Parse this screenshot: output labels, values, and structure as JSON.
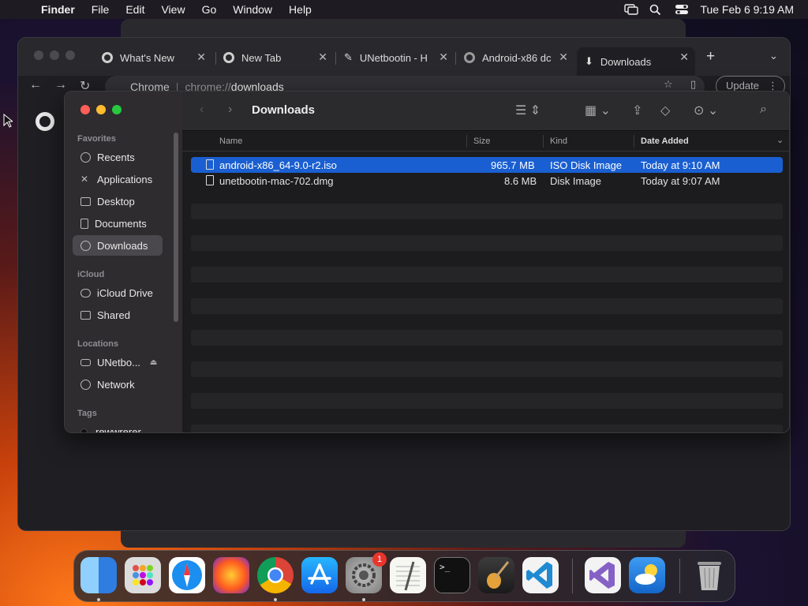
{
  "menubar": {
    "app_name": "Finder",
    "menus": [
      "File",
      "Edit",
      "View",
      "Go",
      "Window",
      "Help"
    ],
    "datetime": "Tue Feb 6  9:19 AM"
  },
  "chrome": {
    "tabs": [
      {
        "label": "What's New"
      },
      {
        "label": "New Tab"
      },
      {
        "label": "UNetbootin - H"
      },
      {
        "label": "Android-x86 dc"
      },
      {
        "label": "Downloads"
      }
    ],
    "omnibox": {
      "site": "Chrome",
      "url_prefix": "chrome://",
      "url_path": "downloads"
    },
    "update_label": "Update"
  },
  "finder": {
    "title": "Downloads",
    "sidebar": {
      "favorites_header": "Favorites",
      "favorites": [
        {
          "label": "Recents",
          "icon": "clock-icon"
        },
        {
          "label": "Applications",
          "icon": "applications-icon"
        },
        {
          "label": "Desktop",
          "icon": "desktop-icon"
        },
        {
          "label": "Documents",
          "icon": "document-icon"
        },
        {
          "label": "Downloads",
          "icon": "download-icon"
        }
      ],
      "icloud_header": "iCloud",
      "icloud": [
        {
          "label": "iCloud Drive",
          "icon": "cloud-icon"
        },
        {
          "label": "Shared",
          "icon": "shared-folder-icon"
        }
      ],
      "locations_header": "Locations",
      "locations": [
        {
          "label": "UNetbo...",
          "icon": "drive-icon"
        },
        {
          "label": "Network",
          "icon": "globe-icon"
        }
      ],
      "tags_header": "Tags",
      "tags": [
        {
          "label": "rewwrerer"
        }
      ]
    },
    "columns": {
      "name": "Name",
      "size": "Size",
      "kind": "Kind",
      "date_added": "Date Added"
    },
    "files": [
      {
        "name": "android-x86_64-9.0-r2.iso",
        "size": "965.7 MB",
        "kind": "ISO Disk Image",
        "date_added": "Today at 9:10 AM",
        "selected": true
      },
      {
        "name": "unetbootin-mac-702.dmg",
        "size": "8.6 MB",
        "kind": "Disk Image",
        "date_added": "Today at 9:07 AM",
        "selected": false
      }
    ]
  },
  "dock": {
    "apps": [
      "finder-icon",
      "launchpad-icon",
      "safari-icon",
      "firefox-icon",
      "chrome-icon",
      "app-store-icon",
      "system-settings-icon",
      "textedit-icon",
      "terminal-icon",
      "garageband-icon",
      "vscode-icon",
      "visual-studio-icon",
      "weather-icon",
      "trash-icon"
    ],
    "settings_badge": "1"
  }
}
